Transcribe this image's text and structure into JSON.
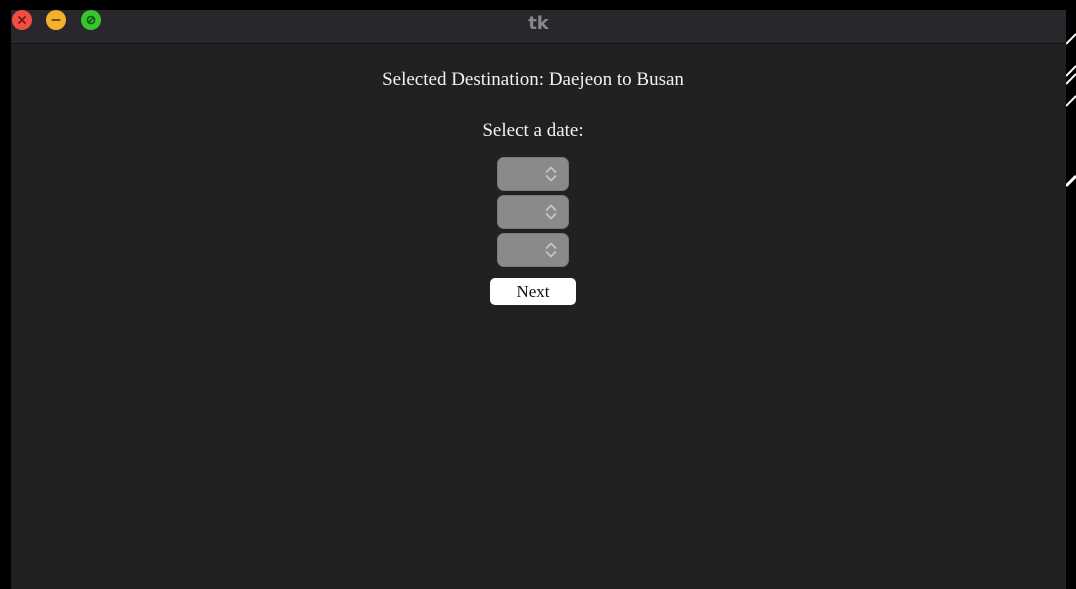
{
  "window": {
    "title": "tk",
    "controls": {
      "close_icon": "close-icon",
      "minimize_icon": "minimize-icon",
      "zoom_icon": "zoom-icon"
    }
  },
  "main": {
    "destination_label": "Selected Destination: Daejeon to Busan",
    "date_prompt": "Select a date:",
    "spinboxes": [
      {
        "value": "",
        "icon": "chevron-updown-icon"
      },
      {
        "value": "",
        "icon": "chevron-updown-icon"
      },
      {
        "value": "",
        "icon": "chevron-updown-icon"
      }
    ],
    "next_label": "Next"
  },
  "colors": {
    "background": "#212121",
    "titlebar": "#29272c",
    "text": "#f2f2f2",
    "spinbox": "#8a8a8a",
    "button": "#ffffff",
    "close": "#ee4e43",
    "minimize": "#f3b12c",
    "zoom": "#38c531"
  }
}
